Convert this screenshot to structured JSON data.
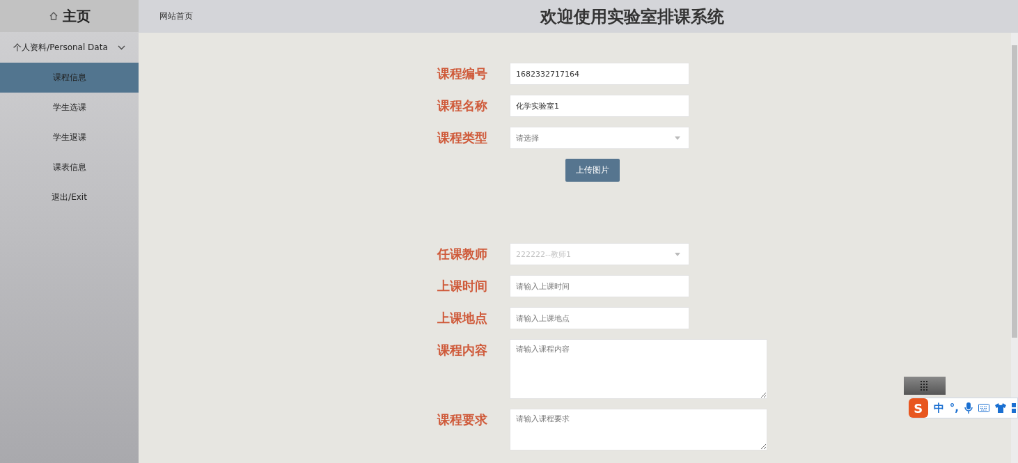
{
  "sidebar": {
    "title": "主页",
    "groups": [
      {
        "label": "个人资料/Personal Data",
        "expanded": true,
        "items": [
          {
            "label": "课程信息",
            "selected": true
          },
          {
            "label": "学生选课",
            "selected": false
          },
          {
            "label": "学生退课",
            "selected": false
          },
          {
            "label": "课表信息",
            "selected": false
          },
          {
            "label": "退出/Exit",
            "selected": false
          }
        ]
      }
    ]
  },
  "header": {
    "breadcrumb": "网站首页",
    "title": "欢迎使用实验室排课系统"
  },
  "form": {
    "fields": [
      {
        "kind": "text",
        "label": "课程编号",
        "value": "1682332717164"
      },
      {
        "kind": "text",
        "label": "课程名称",
        "value": "化学实验室1"
      },
      {
        "kind": "select",
        "label": "课程类型",
        "placeholder": "请选择",
        "disabled": false
      },
      {
        "kind": "upload",
        "label": "上传图片"
      },
      {
        "kind": "spacer"
      },
      {
        "kind": "select",
        "label": "任课教师",
        "value": "222222--教师1",
        "disabled": true
      },
      {
        "kind": "text",
        "label": "上课时间",
        "placeholder": "请输入上课时间"
      },
      {
        "kind": "text",
        "label": "上课地点",
        "placeholder": "请输入上课地点"
      },
      {
        "kind": "textarea",
        "label": "课程内容",
        "placeholder": "请输入课程内容"
      },
      {
        "kind": "note",
        "label": "课程要求",
        "placeholder": "请输入课程要求"
      }
    ]
  },
  "ime_toolbar": {
    "logo": "S",
    "mode": "中",
    "punctuation": "°,"
  }
}
